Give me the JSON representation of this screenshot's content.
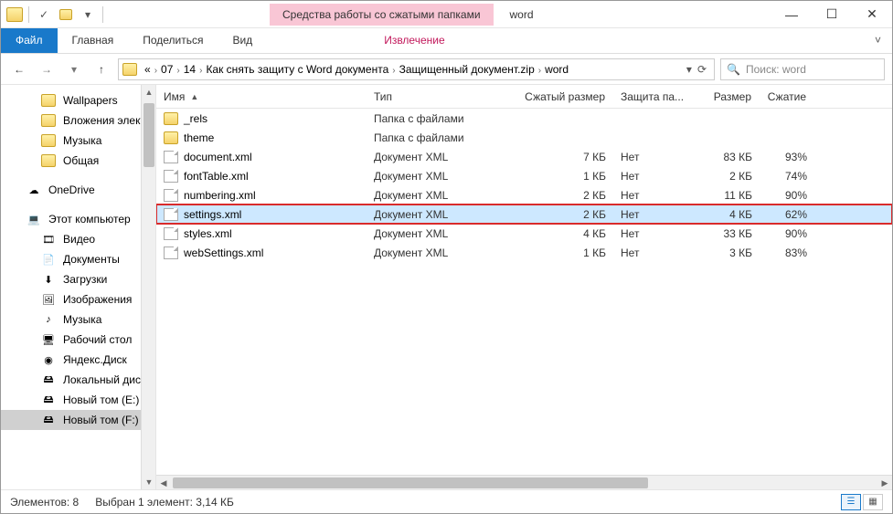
{
  "window": {
    "context_tab": "Средства работы со сжатыми папками",
    "title": "word"
  },
  "ribbon": {
    "file": "Файл",
    "home": "Главная",
    "share": "Поделиться",
    "view": "Вид",
    "extract": "Извлечение"
  },
  "breadcrumb": [
    "«",
    "07",
    "14",
    "Как снять защиту с Word документа",
    "Защищенный документ.zip",
    "word"
  ],
  "search": {
    "placeholder": "Поиск: word"
  },
  "sidebar": [
    {
      "label": "Wallpapers",
      "icon": "folder",
      "lvl": 1
    },
    {
      "label": "Вложения электр",
      "icon": "folder",
      "lvl": 1
    },
    {
      "label": "Музыка",
      "icon": "folder",
      "lvl": 1
    },
    {
      "label": "Общая",
      "icon": "folder",
      "lvl": 1
    },
    {
      "label": "",
      "spacer": true
    },
    {
      "label": "OneDrive",
      "icon": "onedrive",
      "lvl": 0
    },
    {
      "label": "",
      "spacer": true
    },
    {
      "label": "Этот компьютер",
      "icon": "pc",
      "lvl": 0
    },
    {
      "label": "Видео",
      "icon": "video",
      "lvl": 1
    },
    {
      "label": "Документы",
      "icon": "docs",
      "lvl": 1
    },
    {
      "label": "Загрузки",
      "icon": "download",
      "lvl": 1
    },
    {
      "label": "Изображения",
      "icon": "images",
      "lvl": 1
    },
    {
      "label": "Музыка",
      "icon": "music",
      "lvl": 1
    },
    {
      "label": "Рабочий стол",
      "icon": "desktop",
      "lvl": 1
    },
    {
      "label": "Яндекс.Диск",
      "icon": "yadisk",
      "lvl": 1
    },
    {
      "label": "Локальный диск",
      "icon": "disk",
      "lvl": 1
    },
    {
      "label": "Новый том (E:)",
      "icon": "disk",
      "lvl": 1
    },
    {
      "label": "Новый том (F:)",
      "icon": "disk",
      "lvl": 1,
      "selected": true
    }
  ],
  "columns": {
    "name": "Имя",
    "type": "Тип",
    "compressed_size": "Сжатый размер",
    "protection": "Защита па...",
    "size": "Размер",
    "ratio": "Сжатие"
  },
  "files": [
    {
      "name": "_rels",
      "icon": "folder",
      "type": "Папка с файлами",
      "csize": "",
      "prot": "",
      "size": "",
      "ratio": ""
    },
    {
      "name": "theme",
      "icon": "folder",
      "type": "Папка с файлами",
      "csize": "",
      "prot": "",
      "size": "",
      "ratio": ""
    },
    {
      "name": "document.xml",
      "icon": "file",
      "type": "Документ XML",
      "csize": "7 КБ",
      "prot": "Нет",
      "size": "83 КБ",
      "ratio": "93%"
    },
    {
      "name": "fontTable.xml",
      "icon": "file",
      "type": "Документ XML",
      "csize": "1 КБ",
      "prot": "Нет",
      "size": "2 КБ",
      "ratio": "74%"
    },
    {
      "name": "numbering.xml",
      "icon": "file",
      "type": "Документ XML",
      "csize": "2 КБ",
      "prot": "Нет",
      "size": "11 КБ",
      "ratio": "90%"
    },
    {
      "name": "settings.xml",
      "icon": "file",
      "type": "Документ XML",
      "csize": "2 КБ",
      "prot": "Нет",
      "size": "4 КБ",
      "ratio": "62%",
      "selected": true,
      "highlight": true
    },
    {
      "name": "styles.xml",
      "icon": "file",
      "type": "Документ XML",
      "csize": "4 КБ",
      "prot": "Нет",
      "size": "33 КБ",
      "ratio": "90%"
    },
    {
      "name": "webSettings.xml",
      "icon": "file",
      "type": "Документ XML",
      "csize": "1 КБ",
      "prot": "Нет",
      "size": "3 КБ",
      "ratio": "83%"
    }
  ],
  "status": {
    "count_label": "Элементов: 8",
    "selection_label": "Выбран 1 элемент: 3,14 КБ"
  },
  "icons": {
    "onedrive": "☁",
    "pc": "💻",
    "video": "🎞",
    "docs": "📄",
    "download": "⬇",
    "images": "🖼",
    "music": "♪",
    "desktop": "🖥",
    "yadisk": "◉",
    "disk": "🖴",
    "check": "✓",
    "dd": "▾",
    "back": "←",
    "fwd": "→",
    "up": "↑",
    "refresh": "⟳",
    "search": "🔍"
  }
}
